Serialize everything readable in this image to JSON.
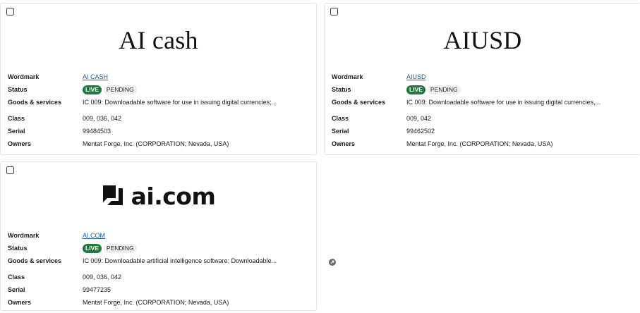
{
  "labels": {
    "wordmark": "Wordmark",
    "status": "Status",
    "goods": "Goods & services",
    "class": "Class",
    "serial": "Serial",
    "owners": "Owners"
  },
  "cards": [
    {
      "mark_text": "AI cash",
      "wordmark": "AI CASH",
      "status_live": "LIVE",
      "status_pending": "PENDING",
      "goods": "IC 009: Downloadable software for use in issuing digital currencies;...",
      "class": "009, 036, 042",
      "serial": "99484503",
      "owners": "Mentat Forge, Inc. (CORPORATION; Nevada, USA)"
    },
    {
      "mark_text": "AIUSD",
      "wordmark": "AIUSD",
      "status_live": "LIVE",
      "status_pending": "PENDING",
      "goods": "IC 009: Downloadable software for use in issuing digital currencies,...",
      "class": "009, 042",
      "serial": "99462502",
      "owners": "Mentat Forge, Inc. (CORPORATION; Nevada, USA)"
    },
    {
      "mark_text": "ai.com",
      "wordmark": "AI.COM",
      "status_live": "LIVE",
      "status_pending": "PENDING",
      "goods": "IC 009: Downloadable artificial intelligence software; Downloadable...",
      "class": "009, 036, 042",
      "serial": "99477235",
      "owners": "Mentat Forge, Inc. (CORPORATION; Nevada, USA)"
    }
  ],
  "icons": {
    "checkbox": "checkbox-icon",
    "external": "external-link-icon",
    "logo": "ai-logo-icon"
  }
}
